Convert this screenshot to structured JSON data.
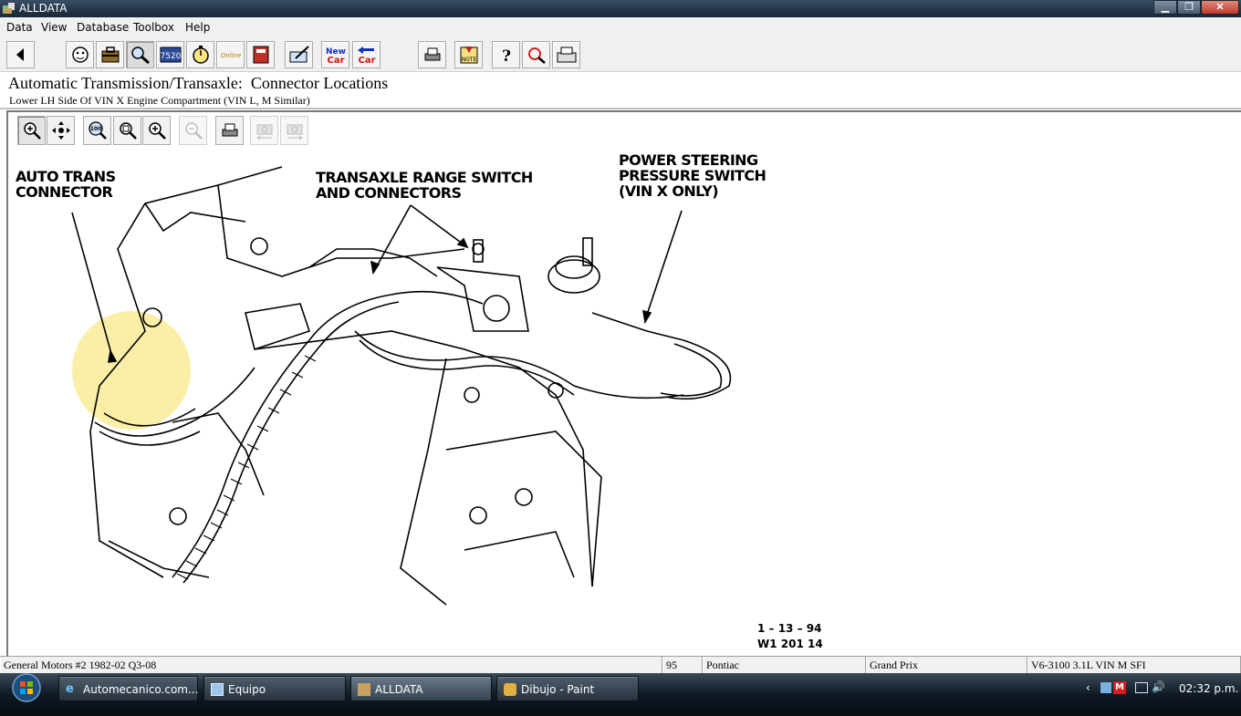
{
  "window": {
    "title": "ALLDATA"
  },
  "menu": [
    "Data",
    "View",
    "Database",
    "Toolbox",
    "Help"
  ],
  "toolbar": {
    "new_car_1": "New\nCar",
    "new_car_2": "New\nCar",
    "num_label": "7520",
    "online_label": "Online",
    "note_label": "NOTE"
  },
  "header": {
    "title": "Automatic Transmission/Transaxle:  Connector Locations",
    "subtitle": "Lower LH Side Of VIN X Engine Compartment (VIN L, M Similar)"
  },
  "diagram": {
    "callouts": {
      "auto_trans": "AUTO TRANS\nCONNECTOR",
      "range_switch": "TRANSAXLE RANGE SWITCH\nAND CONNECTORS",
      "ps_switch": "POWER STEERING\nPRESSURE SWITCH\n(VIN X ONLY)"
    },
    "fig_date": "1 – 13 – 94",
    "fig_code": "W1 201 14"
  },
  "status": {
    "make": "General Motors #2 1982-02 Q3-08",
    "year": "95",
    "brand": "Pontiac",
    "model": "Grand Prix",
    "engine": "V6-3100 3.1L VIN M SFI"
  },
  "taskbar": {
    "items": [
      "Automecanico.com...",
      "Equipo",
      "ALLDATA",
      "Dibujo - Paint"
    ],
    "clock": "02:32 p.m."
  },
  "colors": {
    "highlight": "#fbefa8",
    "taskbar": "#1b2530"
  }
}
